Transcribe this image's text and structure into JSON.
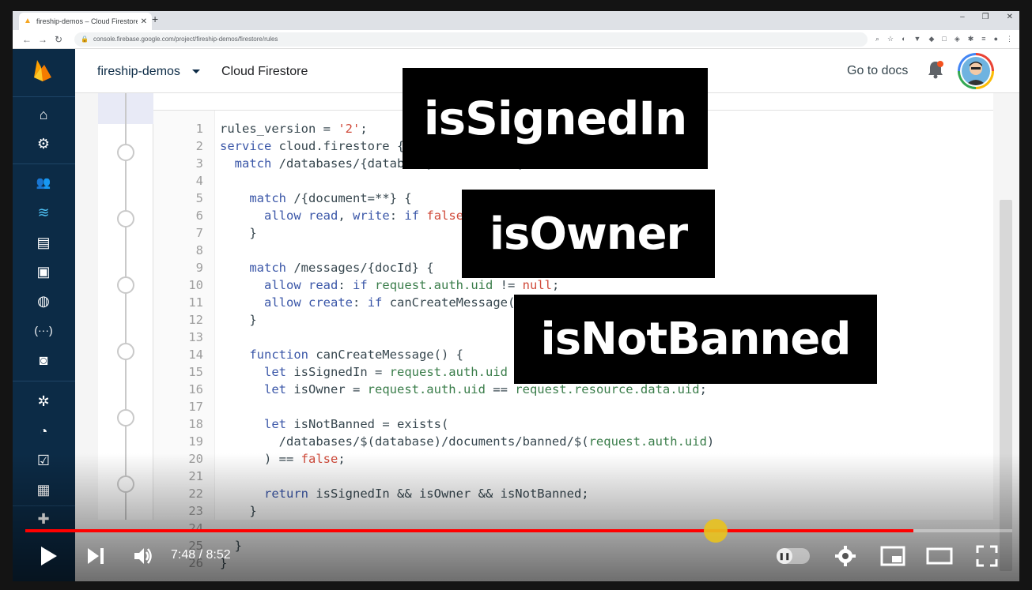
{
  "browser": {
    "tab_title": "fireship-demos – Cloud Firestore",
    "tab_close": "✕",
    "new_tab": "+",
    "url": "console.firebase.google.com/project/fireship-demos/firestore/rules",
    "window_controls": [
      "–",
      "❐",
      "✕"
    ]
  },
  "header": {
    "project": "fireship-demos",
    "product": "Cloud Firestore",
    "docs_link": "Go to docs"
  },
  "sidebar": {
    "icons": [
      "home-icon",
      "gear-icon",
      "users-icon",
      "firestore-icon",
      "database-icon",
      "storage-icon",
      "hosting-icon",
      "functions-icon",
      "ml-icon",
      "crashlytics-icon",
      "performance-icon",
      "test-lab-icon",
      "app-distribution-icon",
      "extensions-icon"
    ]
  },
  "editor": {
    "lines": [
      {
        "n": "1",
        "t": "rules_version = '2';"
      },
      {
        "n": "2",
        "t": "service cloud.firestore {"
      },
      {
        "n": "3",
        "t": "  match /databases/{database}/documents {"
      },
      {
        "n": "4",
        "t": ""
      },
      {
        "n": "5",
        "t": "    match /{document=**} {"
      },
      {
        "n": "6",
        "t": "      allow read, write: if false;"
      },
      {
        "n": "7",
        "t": "    }"
      },
      {
        "n": "8",
        "t": ""
      },
      {
        "n": "9",
        "t": "    match /messages/{docId} {"
      },
      {
        "n": "10",
        "t": "      allow read: if request.auth.uid != null;"
      },
      {
        "n": "11",
        "t": "      allow create: if canCreateMessage();"
      },
      {
        "n": "12",
        "t": "    }"
      },
      {
        "n": "13",
        "t": ""
      },
      {
        "n": "14",
        "t": "    function canCreateMessage() {"
      },
      {
        "n": "15",
        "t": "      let isSignedIn = request.auth.uid != null;"
      },
      {
        "n": "16",
        "t": "      let isOwner = request.auth.uid == request.resource.data.uid;"
      },
      {
        "n": "17",
        "t": ""
      },
      {
        "n": "18",
        "t": "      let isNotBanned = exists("
      },
      {
        "n": "19",
        "t": "        /databases/$(database)/documents/banned/$(request.auth.uid)"
      },
      {
        "n": "20",
        "t": "      ) == false;"
      },
      {
        "n": "21",
        "t": ""
      },
      {
        "n": "22",
        "t": "      return isSignedIn && isOwner && isNotBanned;"
      },
      {
        "n": "23",
        "t": "    }"
      },
      {
        "n": "24",
        "t": ""
      },
      {
        "n": "25",
        "t": "  }"
      },
      {
        "n": "26",
        "t": "}"
      }
    ]
  },
  "overlays": {
    "first": "isSignedIn",
    "second": "isOwner",
    "third": "isNotBanned"
  },
  "video": {
    "time": "7:48 / 8:52",
    "progress": 0.9,
    "accent": "#ff0000"
  }
}
